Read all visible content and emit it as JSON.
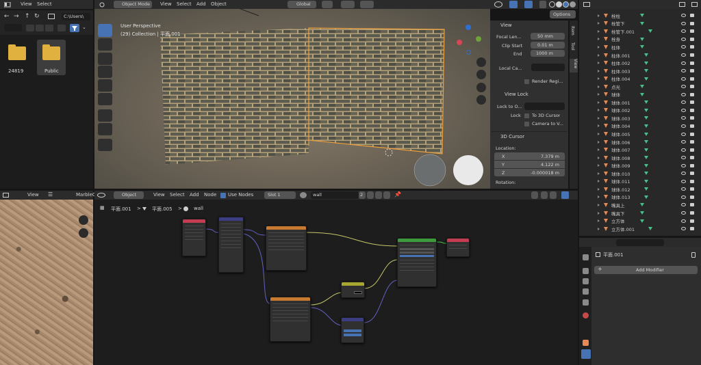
{
  "file_browser": {
    "menu_view": "View",
    "menu_select": "Select",
    "path": "C:\\Users\\",
    "folders": [
      {
        "name": "24819"
      },
      {
        "name": "Public"
      }
    ]
  },
  "viewport": {
    "mode": "Object Mode",
    "menus": [
      "View",
      "Select",
      "Add",
      "Object"
    ],
    "orientation": "Global",
    "options_label": "Options",
    "info_line1": "User Perspective",
    "info_line2": "(29) Collection | 平面.001",
    "tabs": [
      "Item",
      "Tool",
      "View"
    ]
  },
  "npanel": {
    "view_header": "View",
    "focal_label": "Focal Len...",
    "focal_value": "50 mm",
    "clip_start_label": "Clip Start",
    "clip_start_value": "0.01 m",
    "end_label": "End",
    "end_value": "1000 m",
    "local_camera_label": "Local Ca...",
    "render_region_label": "Render Regi...",
    "view_lock_header": "View Lock",
    "lock_to_object_label": "Lock to O...",
    "lock_label": "Lock",
    "to_3d_cursor_label": "To 3D Cursor",
    "camera_to_view_label": "Camera to V...",
    "cursor_header": "3D Cursor",
    "location_label": "Location:",
    "x_label": "X",
    "x_value": "7.379 m",
    "y_label": "Y",
    "y_value": "4.122 m",
    "z_label": "Z",
    "z_value": "-0.000018 m",
    "rotation_label": "Rotation:"
  },
  "outliner": {
    "items": [
      {
        "label": "栓柱"
      },
      {
        "label": "栓管下"
      },
      {
        "label": "栓管下.001"
      },
      {
        "label": "栓身"
      },
      {
        "label": "柱体"
      },
      {
        "label": "柱体.001"
      },
      {
        "label": "柱体.002"
      },
      {
        "label": "柱体.003"
      },
      {
        "label": "柱体.004"
      },
      {
        "label": "点光"
      },
      {
        "label": "球体"
      },
      {
        "label": "球体.001"
      },
      {
        "label": "球体.002"
      },
      {
        "label": "球体.003"
      },
      {
        "label": "球体.004"
      },
      {
        "label": "球体.005"
      },
      {
        "label": "球体.006"
      },
      {
        "label": "球体.007"
      },
      {
        "label": "球体.008"
      },
      {
        "label": "球体.009"
      },
      {
        "label": "球体.010"
      },
      {
        "label": "球体.011"
      },
      {
        "label": "球体.012"
      },
      {
        "label": "球体.013"
      },
      {
        "label": "嘴具上"
      },
      {
        "label": "嘴具下"
      },
      {
        "label": "立方体"
      },
      {
        "label": "立方体.001"
      }
    ]
  },
  "properties": {
    "object_name": "平面.001",
    "add_modifier_label": "Add Modifier"
  },
  "image_editor": {
    "menu_view": "View",
    "image_name": "MarbleC"
  },
  "node_editor": {
    "object_label": "Object",
    "menus": [
      "View",
      "Select",
      "Add",
      "Node"
    ],
    "use_nodes_label": "Use Nodes",
    "slot_label": "Slot 1",
    "material_name": "wall",
    "user_count": "2",
    "breadcrumb": [
      "平面.001",
      "平面.005",
      "wall"
    ]
  },
  "colors": {
    "accent_blue": "#4772b3",
    "selection_orange": "#f5a33a",
    "mesh_green": "#47c08a",
    "object_orange": "#e58a55"
  }
}
